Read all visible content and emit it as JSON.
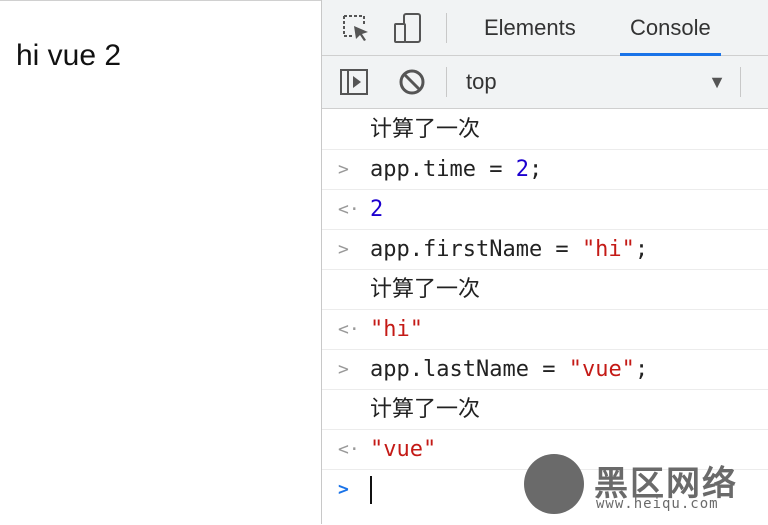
{
  "page": {
    "text": "hi vue 2"
  },
  "devtools": {
    "tabs": [
      {
        "label": "Elements",
        "active": false
      },
      {
        "label": "Console",
        "active": true
      }
    ],
    "toolbar": {
      "context": "top"
    },
    "console": [
      {
        "type": "log",
        "text": "计算了一次"
      },
      {
        "type": "input",
        "code": "app.time",
        "op": " = ",
        "value": "2",
        "end": ";"
      },
      {
        "type": "result",
        "value": "2"
      },
      {
        "type": "input",
        "code": "app.firstName",
        "op": " = ",
        "value": "\"hi\"",
        "end": ";"
      },
      {
        "type": "log",
        "text": "计算了一次"
      },
      {
        "type": "result",
        "value": "\"hi\""
      },
      {
        "type": "input",
        "code": "app.lastName",
        "op": " = ",
        "value": "\"vue\"",
        "end": ";"
      },
      {
        "type": "log",
        "text": "计算了一次"
      },
      {
        "type": "result",
        "value": "\"vue\""
      }
    ]
  },
  "watermark": {
    "title": "黑区网络",
    "url": "www.heiqu.com"
  },
  "icons": {
    "inspect": "inspect-element-icon",
    "device": "device-toolbar-icon",
    "sidebar": "console-sidebar-icon",
    "clear": "clear-console-icon",
    "caret": "dropdown-caret-icon"
  },
  "colors": {
    "accent": "#1a73e8",
    "string": "#c41a16",
    "number": "#1c00cf"
  }
}
